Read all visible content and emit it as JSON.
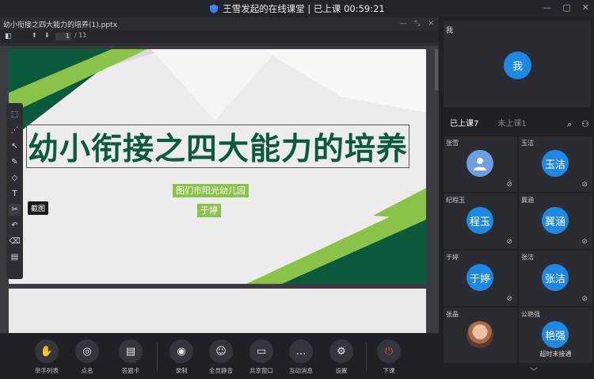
{
  "window": {
    "title": "王雪发起的在线课堂 | 已上课 00:59:21"
  },
  "document": {
    "filename": "幼小衔接之四大能力的培养(1).pptx",
    "page": "1",
    "total_pages": "/ 11"
  },
  "slide": {
    "title": "幼小衔接之四大能力的培养",
    "organization": "图们市阳光幼儿园",
    "presenter": "于婷"
  },
  "toolbar_tooltip": "截图",
  "bottom_toolbar": [
    {
      "label": "举手列表"
    },
    {
      "label": "点名"
    },
    {
      "label": "答题卡"
    },
    {
      "label": "录制"
    },
    {
      "label": "全员静音"
    },
    {
      "label": "共享窗口"
    },
    {
      "label": "互动消息"
    },
    {
      "label": "设置"
    },
    {
      "label": "下课"
    }
  ],
  "teacher": {
    "name": "我",
    "avatar_text": "我"
  },
  "tabs": {
    "in_class": "已上课7",
    "not_in_class": "未上课1"
  },
  "students": [
    {
      "name": "张雪",
      "avatar_text": ""
    },
    {
      "name": "玉洁",
      "avatar_text": "玉洁"
    },
    {
      "name": "纪程玉",
      "avatar_text": "程玉"
    },
    {
      "name": "冀涵",
      "avatar_text": "冀涵"
    },
    {
      "name": "于婷",
      "avatar_text": "于婷"
    },
    {
      "name": "张洁",
      "avatar_text": "张洁"
    },
    {
      "name": "张晶",
      "avatar_text": ""
    },
    {
      "name": "公艳强",
      "avatar_text": "艳强",
      "note": "超时未接通"
    }
  ],
  "colors": {
    "accent": "#1e88e5",
    "slide_title": "#0c5a3c",
    "slide_green": "#8bc34a",
    "end_class": "#e0533d"
  }
}
